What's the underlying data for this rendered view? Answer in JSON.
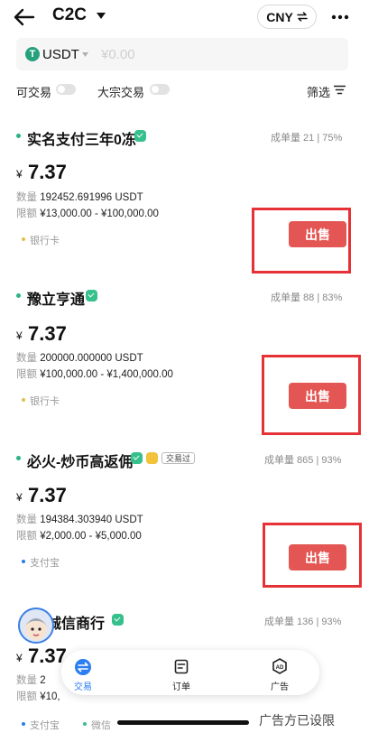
{
  "header": {
    "title": "C2C",
    "currency_label": "CNY"
  },
  "search": {
    "coin": "USDT",
    "coin_icon_text": "T",
    "amount_placeholder": "¥0.00"
  },
  "filters": {
    "tradable_label": "可交易",
    "bulk_label": "大宗交易",
    "filter_label": "筛选"
  },
  "listings": [
    {
      "merchant": "实名支付三年0冻",
      "stats_orders": "成单量 21",
      "stats_rate": "75%",
      "currency_symbol": "¥",
      "price": "7.37",
      "qty_key": "数量",
      "qty_value": "192452.691996 USDT",
      "limit_key": "限额",
      "limit_value": "¥13,000.00 - ¥100,000.00",
      "payments": [
        "银行卡"
      ],
      "sell_label": "出售"
    },
    {
      "merchant": "豫立亨通",
      "stats_orders": "成单量 88",
      "stats_rate": "83%",
      "currency_symbol": "¥",
      "price": "7.37",
      "qty_key": "数量",
      "qty_value": "200000.000000 USDT",
      "limit_key": "限额",
      "limit_value": "¥100,000.00 - ¥1,400,000.00",
      "payments": [
        "银行卡"
      ],
      "sell_label": "出售"
    },
    {
      "merchant": "必火-炒币高返佣",
      "badge": "交易过",
      "stats_orders": "成单量 865",
      "stats_rate": "93%",
      "currency_symbol": "¥",
      "price": "7.37",
      "qty_key": "数量",
      "qty_value": "194384.303940 USDT",
      "limit_key": "限额",
      "limit_value": "¥2,000.00 - ¥5,000.00",
      "payments": [
        "支付宝"
      ],
      "sell_label": "出售"
    },
    {
      "merchant": "诚信商行",
      "stats_orders": "成单量 136",
      "stats_rate": "93%",
      "currency_symbol": "¥",
      "price": "7.37",
      "qty_key": "数量",
      "qty_value": "2",
      "limit_key": "限额",
      "limit_value": "¥10,",
      "payments": [
        "支付宝",
        "微信"
      ]
    }
  ],
  "nav": {
    "items": [
      {
        "label": "交易",
        "icon": "swap-icon"
      },
      {
        "label": "订单",
        "icon": "order-icon"
      },
      {
        "label": "广告",
        "icon": "ad-icon",
        "icon_text": "AD"
      }
    ]
  },
  "ad_status": "广告方已设限",
  "colors": {
    "sell": "#e35654",
    "accent": "#2a7df2",
    "highlight": "#e63237",
    "green": "#2bb389"
  }
}
